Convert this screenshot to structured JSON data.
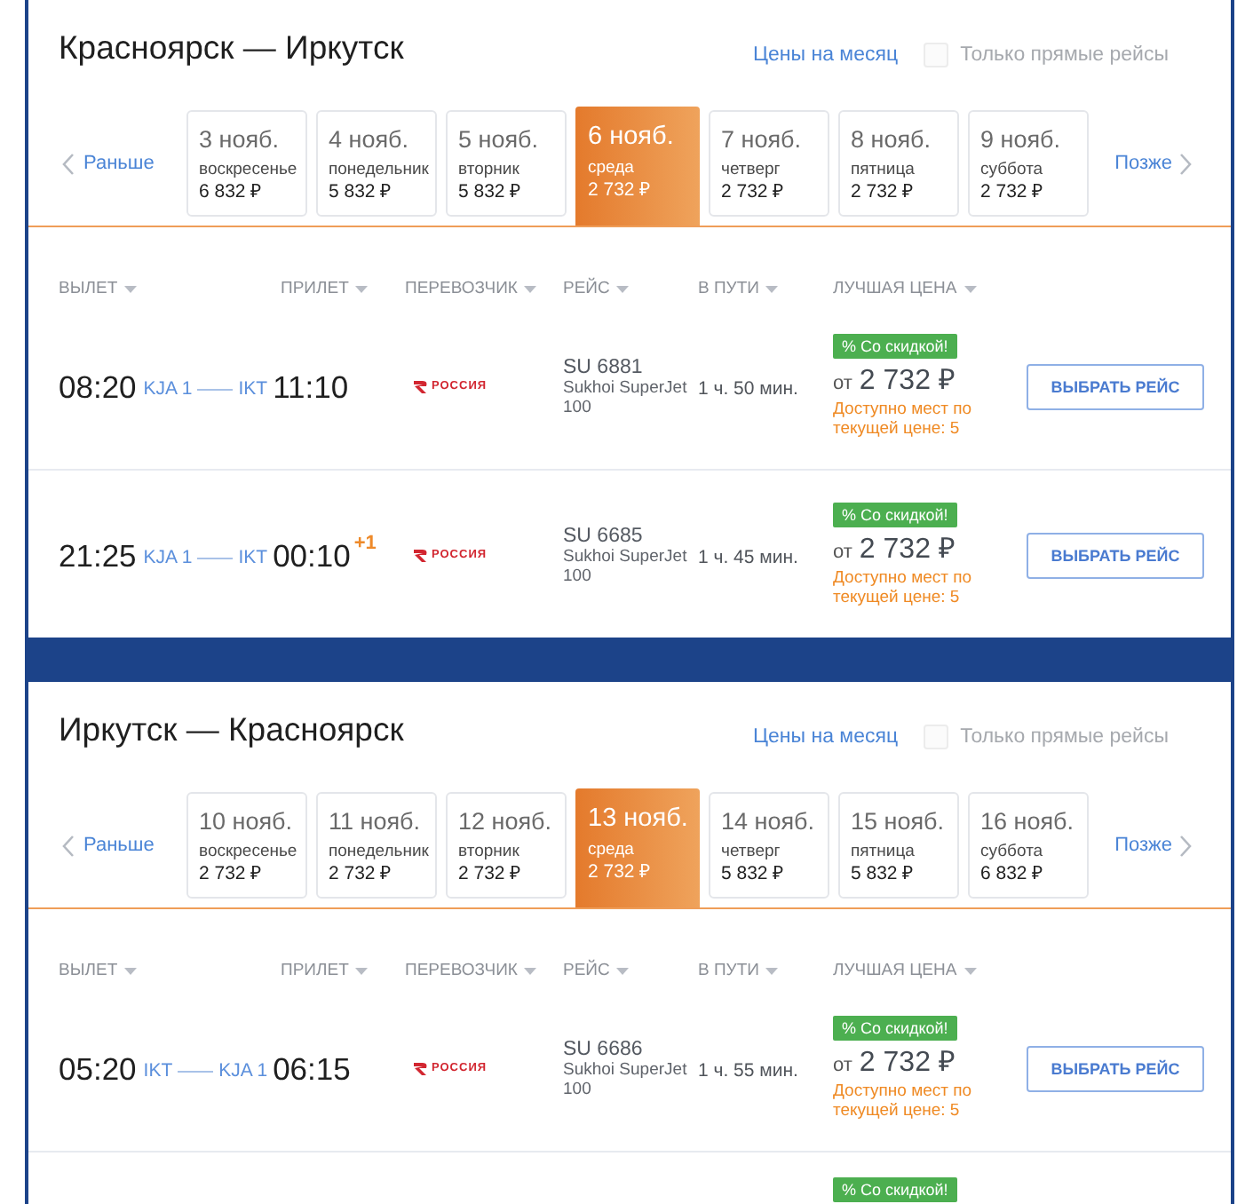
{
  "sections": [
    {
      "title": "Красноярск — Иркутск",
      "month_prices_link": "Цены на месяц",
      "direct_only": {
        "label": "Только прямые рейсы",
        "checked": false
      },
      "earlier": "Раньше",
      "later": "Позже",
      "dates": [
        {
          "date": "3 нояб.",
          "weekday": "воскресенье",
          "price": "6 832 ₽",
          "selected": false
        },
        {
          "date": "4 нояб.",
          "weekday": "понедельник",
          "price": "5 832 ₽",
          "selected": false
        },
        {
          "date": "5 нояб.",
          "weekday": "вторник",
          "price": "5 832 ₽",
          "selected": false
        },
        {
          "date": "6 нояб.",
          "weekday": "среда",
          "price": "2 732 ₽",
          "selected": true
        },
        {
          "date": "7 нояб.",
          "weekday": "четверг",
          "price": "2 732 ₽",
          "selected": false
        },
        {
          "date": "8 нояб.",
          "weekday": "пятница",
          "price": "2 732 ₽",
          "selected": false
        },
        {
          "date": "9 нояб.",
          "weekday": "суббота",
          "price": "2 732 ₽",
          "selected": false
        }
      ],
      "columns": [
        "ВЫЛЕТ",
        "ПРИЛЕТ",
        "ПЕРЕВОЗЧИК",
        "РЕЙС",
        "В ПУТИ",
        "ЛУЧШАЯ ЦЕНА"
      ],
      "flights": [
        {
          "departure": "08:20",
          "from": "KJA 1",
          "to": "IKT",
          "arrival": "11:10",
          "carrier": "РОССИЯ",
          "flight_number": "SU 6881",
          "aircraft": "Sukhoi SuperJet 100",
          "duration": "1 ч. 50 мин.",
          "badge": "% Со скидкой!",
          "price_prefix": "от",
          "price": "2 732 ₽",
          "availability": "Доступно мест по текущей цене: 5",
          "button": "ВЫБРАТЬ РЕЙС"
        },
        {
          "departure": "21:25",
          "from": "KJA 1",
          "to": "IKT",
          "arrival": "00:10",
          "day_offset": "+1",
          "carrier": "РОССИЯ",
          "flight_number": "SU 6685",
          "aircraft": "Sukhoi SuperJet 100",
          "duration": "1 ч. 45 мин.",
          "badge": "% Со скидкой!",
          "price_prefix": "от",
          "price": "2 732 ₽",
          "availability": "Доступно мест по текущей цене: 5",
          "button": "ВЫБРАТЬ РЕЙС"
        }
      ]
    },
    {
      "title": "Иркутск — Красноярск",
      "month_prices_link": "Цены на месяц",
      "direct_only": {
        "label": "Только прямые рейсы",
        "checked": false
      },
      "earlier": "Раньше",
      "later": "Позже",
      "dates": [
        {
          "date": "10 нояб.",
          "weekday": "воскресенье",
          "price": "2 732 ₽",
          "selected": false
        },
        {
          "date": "11 нояб.",
          "weekday": "понедельник",
          "price": "2 732 ₽",
          "selected": false
        },
        {
          "date": "12 нояб.",
          "weekday": "вторник",
          "price": "2 732 ₽",
          "selected": false
        },
        {
          "date": "13 нояб.",
          "weekday": "среда",
          "price": "2 732 ₽",
          "selected": true
        },
        {
          "date": "14 нояб.",
          "weekday": "четверг",
          "price": "5 832 ₽",
          "selected": false
        },
        {
          "date": "15 нояб.",
          "weekday": "пятница",
          "price": "5 832 ₽",
          "selected": false
        },
        {
          "date": "16 нояб.",
          "weekday": "суббота",
          "price": "6 832 ₽",
          "selected": false
        }
      ],
      "columns": [
        "ВЫЛЕТ",
        "ПРИЛЕТ",
        "ПЕРЕВОЗЧИК",
        "РЕЙС",
        "В ПУТИ",
        "ЛУЧШАЯ ЦЕНА"
      ],
      "flights": [
        {
          "departure": "05:20",
          "from": "IKT",
          "to": "KJA 1",
          "arrival": "06:15",
          "carrier": "РОССИЯ",
          "flight_number": "SU 6686",
          "aircraft": "Sukhoi SuperJet 100",
          "duration": "1 ч. 55 мин.",
          "badge": "% Со скидкой!",
          "price_prefix": "от",
          "price": "2 732 ₽",
          "availability": "Доступно мест по текущей цене: 5",
          "button": "ВЫБРАТЬ РЕЙС"
        },
        {
          "badge": "% Со скидкой!"
        }
      ]
    }
  ]
}
